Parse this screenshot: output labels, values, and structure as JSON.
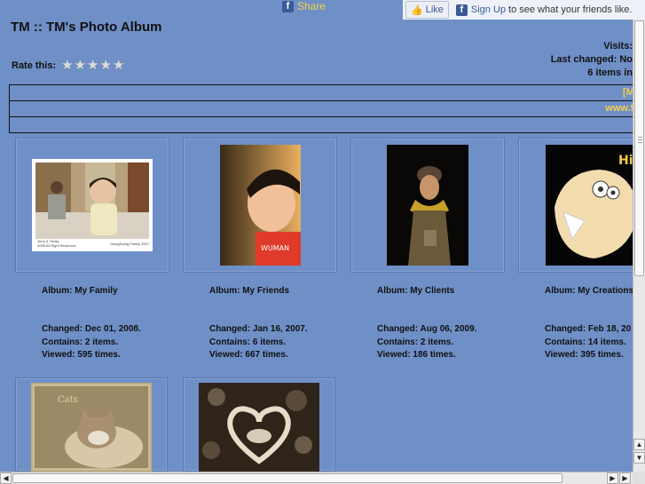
{
  "facebook": {
    "share_label": "Share",
    "like_label": "Like",
    "signup_link": "Sign Up",
    "signup_text": "to see what your friends like.",
    "brand_color": "#3b5998"
  },
  "header": {
    "title": "TM :: TM's Photo Album",
    "rate_label": "Rate this:",
    "stars_total": 5,
    "stars_rated": 0,
    "stats": {
      "visits": "Visits:",
      "last_changed": "Last changed: No",
      "items": "6 items in"
    }
  },
  "links_rows": [
    "[Me",
    "www.fo",
    ""
  ],
  "albums": [
    {
      "title": "Album: My Family",
      "changed": "Changed: Dec 01, 2008.",
      "contains": "Contains: 2 items.",
      "viewed": "Viewed: 595 times.",
      "caption_left": "Jerry & Trinity",
      "caption_right": "2008 All Right Reserved",
      "caption_corner": "DoingDoing Family 2007"
    },
    {
      "title": "Album: My Friends",
      "changed": "Changed: Jan 16, 2007.",
      "contains": "Contains: 6 items.",
      "viewed": "Viewed: 667 times."
    },
    {
      "title": "Album: My Clients",
      "changed": "Changed: Aug 06, 2009.",
      "contains": "Contains: 2 items.",
      "viewed": "Viewed: 186 times."
    },
    {
      "title": "Album: My Creations",
      "changed": "Changed: Feb 18, 20",
      "contains": "Contains: 14 items.",
      "viewed": "Viewed: 395 times.",
      "thumb_text": "Hi"
    },
    {
      "title": "",
      "thumb_text": "Cats"
    },
    {
      "title": ""
    }
  ],
  "colors": {
    "page_bg": "#6f8fc7",
    "link_yellow": "#f2d04a",
    "frame_border": "#5a78b0"
  }
}
